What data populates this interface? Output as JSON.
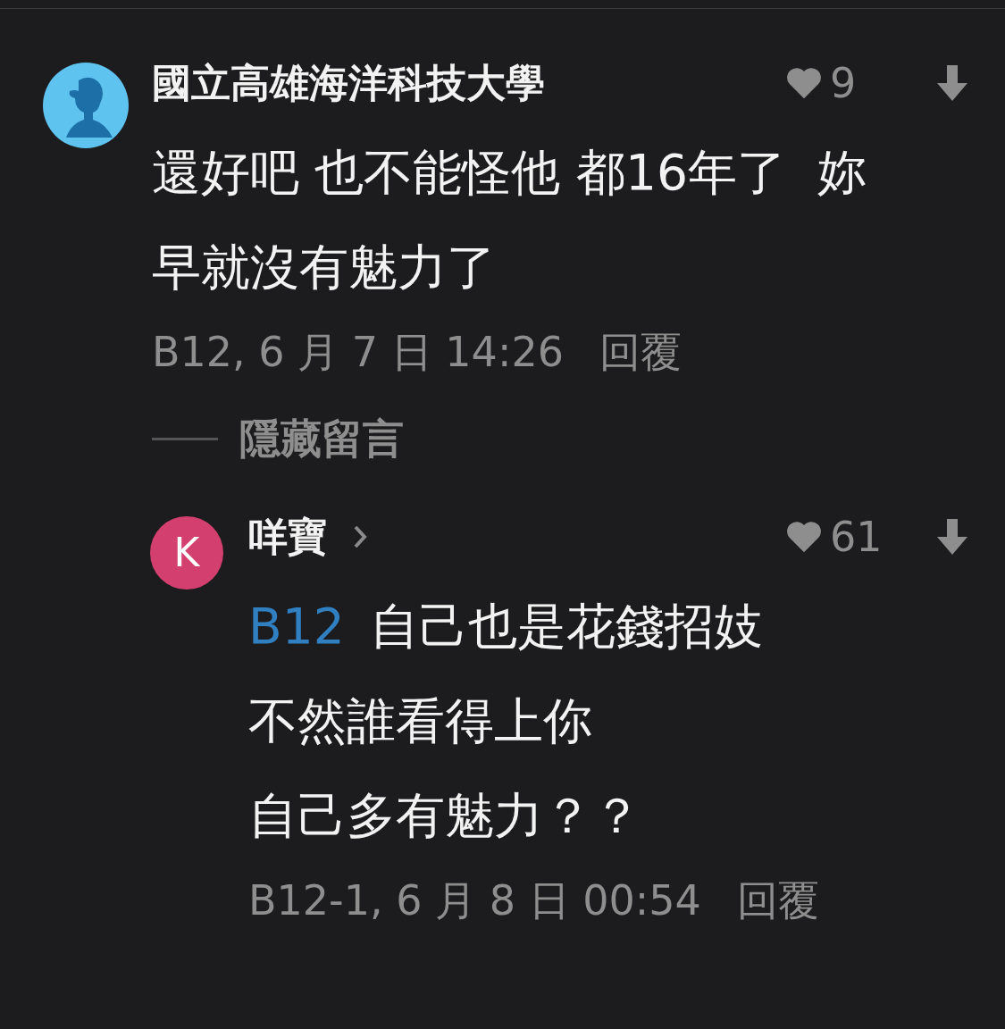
{
  "comments": [
    {
      "kind": "comment",
      "author": "國立高雄海洋科技大學",
      "avatar": {
        "kind": "silhouette",
        "color": "#5fc3f0"
      },
      "likes": "9",
      "lines": [
        "還好吧 也不能怪他 都16年了  妳",
        "早就沒有魅力了"
      ],
      "meta": "B12, 6 月 7 日 14:26",
      "reply_label": "回覆",
      "hide_label": "隱藏留言"
    },
    {
      "kind": "reply",
      "author": "咩寶",
      "avatar": {
        "kind": "letter",
        "letter": "K",
        "color": "#d33f6f"
      },
      "likes": "61",
      "mention": "B12",
      "lines": [
        "自己也是花錢招妓",
        "不然誰看得上你",
        "自己多有魅力？？"
      ],
      "meta": "B12-1, 6 月 8 日 00:54",
      "reply_label": "回覆"
    }
  ]
}
